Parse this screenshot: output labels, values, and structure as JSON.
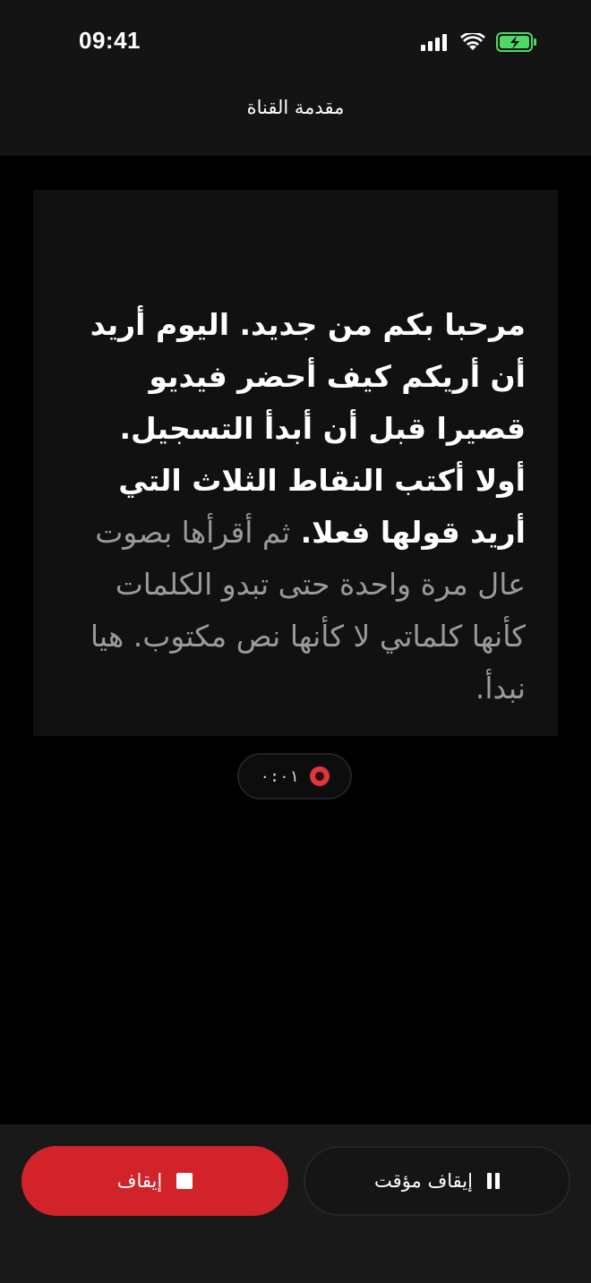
{
  "status_bar": {
    "time": "09:41"
  },
  "header": {
    "title": "مقدمة القناة"
  },
  "script": {
    "read_text": "مرحبا بكم من جديد. اليوم أريد أن أريكم كيف أحضر فيديو قصيرا قبل أن أبدأ التسجيل. أولا أكتب النقاط الثلاث التي أريد قولها فعلا.",
    "unread_text": "ثم أقرأها بصوت عال مرة واحدة حتى تبدو الكلمات كأنها كلماتي لا كأنها نص مكتوب. هيا نبدأ."
  },
  "recording": {
    "elapsed": "٠:٠١",
    "indicator_color": "#e0353c"
  },
  "controls": {
    "pause_label": "إيقاف مؤقت",
    "stop_label": "إيقاف",
    "stop_color": "#d2232a"
  },
  "icons": {
    "signal": "cellular-signal-icon",
    "wifi": "wifi-icon",
    "battery": "battery-charging-icon",
    "pause": "pause-icon",
    "stop": "stop-icon",
    "record": "record-indicator-icon"
  }
}
